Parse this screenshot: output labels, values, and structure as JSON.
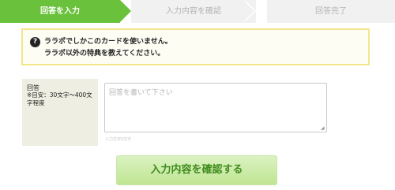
{
  "steps": [
    {
      "label": "回答を入力",
      "state": "active"
    },
    {
      "label": "入力内容を確認",
      "state": "inactive"
    },
    {
      "label": "回答完了",
      "state": "inactive"
    }
  ],
  "notice": {
    "icon": "question-circle-icon",
    "line1": "ララポでしかこのカードを使いません。",
    "line2": "ララポ以外の特典を教えてください。"
  },
  "form": {
    "label": "回答",
    "note": "※目安：30文字〜400文字程度",
    "placeholder": "回答を書いて下さい",
    "char_count": "入力文字0文字"
  },
  "confirm_button": {
    "label": "入力内容を確認する"
  },
  "colors": {
    "accent": "#6ac13c",
    "step_inactive_bg": "#f1f1f1",
    "notice_border": "#f3e68a",
    "label_bg": "#eeeee2",
    "button_text": "#3f8a1c"
  }
}
